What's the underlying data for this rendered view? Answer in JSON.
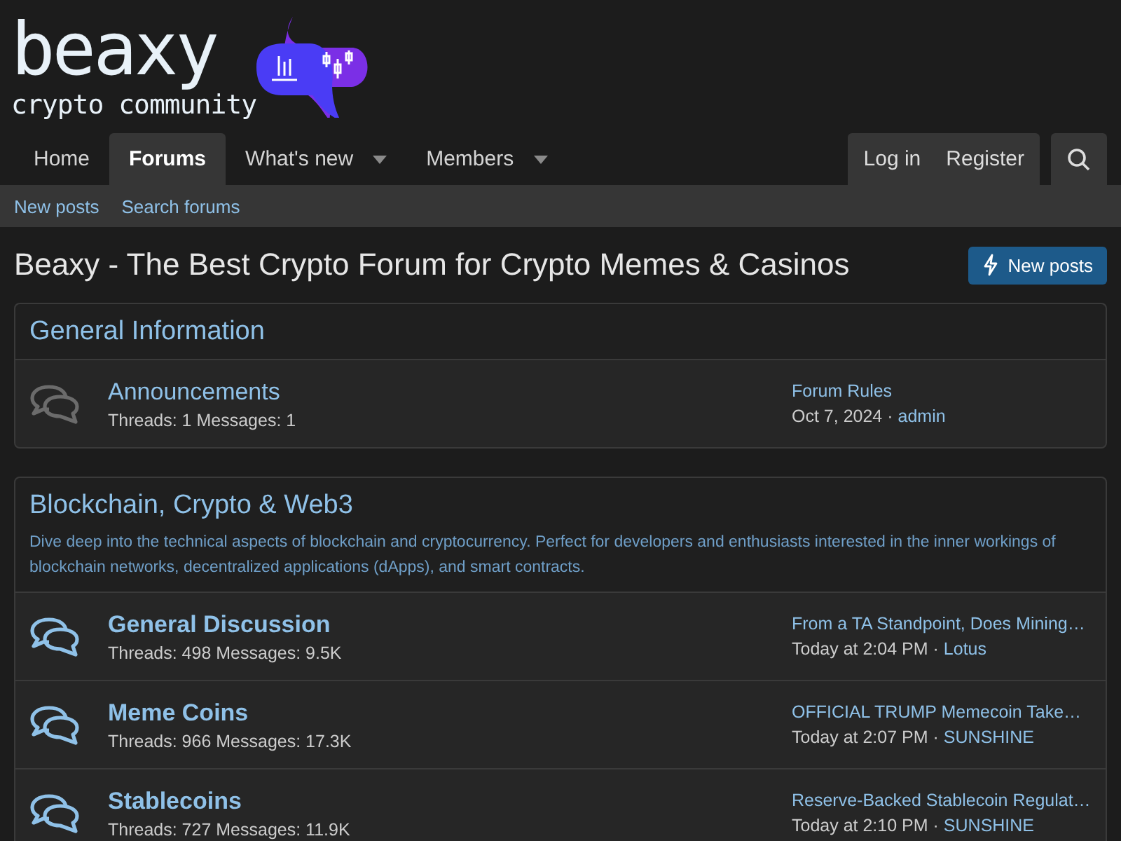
{
  "logo": {
    "name": "beaxy",
    "tagline": "crypto community"
  },
  "nav": {
    "tabs": [
      {
        "label": "Home",
        "selected": false,
        "dropdown": false
      },
      {
        "label": "Forums",
        "selected": true,
        "dropdown": false
      },
      {
        "label": "What's new",
        "selected": false,
        "dropdown": true
      },
      {
        "label": "Members",
        "selected": false,
        "dropdown": true
      }
    ],
    "account": [
      "Log in",
      "Register"
    ]
  },
  "subnav": [
    "New posts",
    "Search forums"
  ],
  "page": {
    "title": "Beaxy - The Best Crypto Forum for Crypto Memes & Casinos",
    "button": "New posts"
  },
  "categories": [
    {
      "title": "General Information",
      "forums": [
        {
          "name": "Announcements",
          "unread": false,
          "stats": "Threads: 1 Messages: 1",
          "latest": {
            "title": "Forum Rules",
            "date": "Oct 7, 2024",
            "separator": "·",
            "user": "admin"
          }
        }
      ]
    },
    {
      "title": "Blockchain, Crypto & Web3",
      "description": "Dive deep into the technical aspects of blockchain and cryptocurrency. Perfect for developers and enthusiasts interested in the inner workings of blockchain networks, decentralized applications (dApps), and smart contracts.",
      "forums": [
        {
          "name": "General Discussion",
          "unread": true,
          "stats": "Threads: 498 Messages: 9.5K",
          "latest": {
            "title": "From a TA Standpoint, Does Mining…",
            "date": "Today at 2:04 PM",
            "separator": "·",
            "user": "Lotus"
          }
        },
        {
          "name": "Meme Coins",
          "unread": true,
          "stats": "Threads: 966 Messages: 17.3K",
          "latest": {
            "title": "OFFICIAL TRUMP Memecoin Take…",
            "date": "Today at 2:07 PM",
            "separator": "·",
            "user": "SUNSHINE"
          }
        },
        {
          "name": "Stablecoins",
          "unread": true,
          "stats": "Threads: 727 Messages: 11.9K",
          "latest": {
            "title": "Reserve-Backed Stablecoin Regulat…",
            "date": "Today at 2:10 PM",
            "separator": "·",
            "user": "SUNSHINE"
          }
        }
      ]
    }
  ]
}
